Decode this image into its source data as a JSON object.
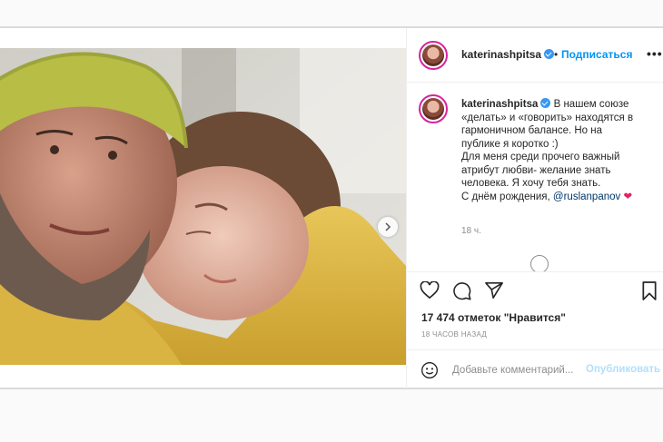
{
  "post": {
    "username": "katerinashpitsa",
    "follow_label": "Подписаться",
    "separator": "•",
    "more_label": "•••",
    "caption_user": "katerinashpitsa",
    "caption_lines": [
      "В нашем союзе",
      "«делать» и «говорить» находятся в",
      "гармоничном балансе. Но на",
      "публике я коротко :)",
      "Для меня среди прочего важный",
      "атрибут любви- желание знать",
      "человека. Я хочу тебя знать.",
      "С днём рождения, "
    ],
    "mention": "@ruslanpanov",
    "heart": "❤",
    "time_ago": "18 ч.",
    "likes": "17 474 отметок \"Нравится\"",
    "posted_ago": "18 часов назад",
    "comment_placeholder": "Добавьте комментарий...",
    "publish_label": "Опубликовать"
  },
  "carousel": {
    "slides": 3,
    "active": 0
  },
  "icons": {
    "verified": "verified-badge-icon",
    "like": "heart-icon",
    "comment": "comment-icon",
    "share": "send-icon",
    "save": "bookmark-icon",
    "emoji": "smiley-icon",
    "next": "chevron-right-icon"
  },
  "colors": {
    "link": "#0095f6",
    "verified": "#3897f0",
    "muted": "#8e8e8e",
    "publish_disabled": "#b2dffc"
  }
}
